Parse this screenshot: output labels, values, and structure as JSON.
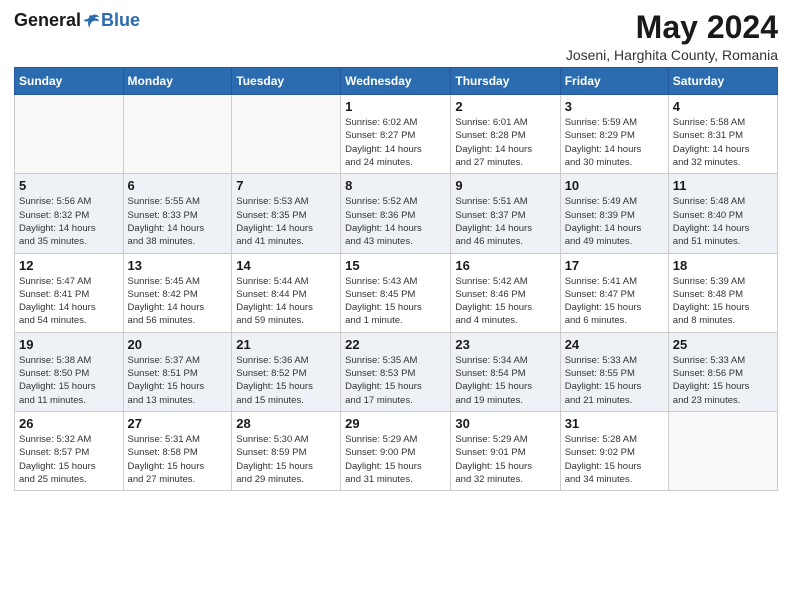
{
  "header": {
    "logo_general": "General",
    "logo_blue": "Blue",
    "month_year": "May 2024",
    "location": "Joseni, Harghita County, Romania"
  },
  "days_of_week": [
    "Sunday",
    "Monday",
    "Tuesday",
    "Wednesday",
    "Thursday",
    "Friday",
    "Saturday"
  ],
  "weeks": [
    [
      {
        "day": "",
        "info": ""
      },
      {
        "day": "",
        "info": ""
      },
      {
        "day": "",
        "info": ""
      },
      {
        "day": "1",
        "info": "Sunrise: 6:02 AM\nSunset: 8:27 PM\nDaylight: 14 hours\nand 24 minutes."
      },
      {
        "day": "2",
        "info": "Sunrise: 6:01 AM\nSunset: 8:28 PM\nDaylight: 14 hours\nand 27 minutes."
      },
      {
        "day": "3",
        "info": "Sunrise: 5:59 AM\nSunset: 8:29 PM\nDaylight: 14 hours\nand 30 minutes."
      },
      {
        "day": "4",
        "info": "Sunrise: 5:58 AM\nSunset: 8:31 PM\nDaylight: 14 hours\nand 32 minutes."
      }
    ],
    [
      {
        "day": "5",
        "info": "Sunrise: 5:56 AM\nSunset: 8:32 PM\nDaylight: 14 hours\nand 35 minutes."
      },
      {
        "day": "6",
        "info": "Sunrise: 5:55 AM\nSunset: 8:33 PM\nDaylight: 14 hours\nand 38 minutes."
      },
      {
        "day": "7",
        "info": "Sunrise: 5:53 AM\nSunset: 8:35 PM\nDaylight: 14 hours\nand 41 minutes."
      },
      {
        "day": "8",
        "info": "Sunrise: 5:52 AM\nSunset: 8:36 PM\nDaylight: 14 hours\nand 43 minutes."
      },
      {
        "day": "9",
        "info": "Sunrise: 5:51 AM\nSunset: 8:37 PM\nDaylight: 14 hours\nand 46 minutes."
      },
      {
        "day": "10",
        "info": "Sunrise: 5:49 AM\nSunset: 8:39 PM\nDaylight: 14 hours\nand 49 minutes."
      },
      {
        "day": "11",
        "info": "Sunrise: 5:48 AM\nSunset: 8:40 PM\nDaylight: 14 hours\nand 51 minutes."
      }
    ],
    [
      {
        "day": "12",
        "info": "Sunrise: 5:47 AM\nSunset: 8:41 PM\nDaylight: 14 hours\nand 54 minutes."
      },
      {
        "day": "13",
        "info": "Sunrise: 5:45 AM\nSunset: 8:42 PM\nDaylight: 14 hours\nand 56 minutes."
      },
      {
        "day": "14",
        "info": "Sunrise: 5:44 AM\nSunset: 8:44 PM\nDaylight: 14 hours\nand 59 minutes."
      },
      {
        "day": "15",
        "info": "Sunrise: 5:43 AM\nSunset: 8:45 PM\nDaylight: 15 hours\nand 1 minute."
      },
      {
        "day": "16",
        "info": "Sunrise: 5:42 AM\nSunset: 8:46 PM\nDaylight: 15 hours\nand 4 minutes."
      },
      {
        "day": "17",
        "info": "Sunrise: 5:41 AM\nSunset: 8:47 PM\nDaylight: 15 hours\nand 6 minutes."
      },
      {
        "day": "18",
        "info": "Sunrise: 5:39 AM\nSunset: 8:48 PM\nDaylight: 15 hours\nand 8 minutes."
      }
    ],
    [
      {
        "day": "19",
        "info": "Sunrise: 5:38 AM\nSunset: 8:50 PM\nDaylight: 15 hours\nand 11 minutes."
      },
      {
        "day": "20",
        "info": "Sunrise: 5:37 AM\nSunset: 8:51 PM\nDaylight: 15 hours\nand 13 minutes."
      },
      {
        "day": "21",
        "info": "Sunrise: 5:36 AM\nSunset: 8:52 PM\nDaylight: 15 hours\nand 15 minutes."
      },
      {
        "day": "22",
        "info": "Sunrise: 5:35 AM\nSunset: 8:53 PM\nDaylight: 15 hours\nand 17 minutes."
      },
      {
        "day": "23",
        "info": "Sunrise: 5:34 AM\nSunset: 8:54 PM\nDaylight: 15 hours\nand 19 minutes."
      },
      {
        "day": "24",
        "info": "Sunrise: 5:33 AM\nSunset: 8:55 PM\nDaylight: 15 hours\nand 21 minutes."
      },
      {
        "day": "25",
        "info": "Sunrise: 5:33 AM\nSunset: 8:56 PM\nDaylight: 15 hours\nand 23 minutes."
      }
    ],
    [
      {
        "day": "26",
        "info": "Sunrise: 5:32 AM\nSunset: 8:57 PM\nDaylight: 15 hours\nand 25 minutes."
      },
      {
        "day": "27",
        "info": "Sunrise: 5:31 AM\nSunset: 8:58 PM\nDaylight: 15 hours\nand 27 minutes."
      },
      {
        "day": "28",
        "info": "Sunrise: 5:30 AM\nSunset: 8:59 PM\nDaylight: 15 hours\nand 29 minutes."
      },
      {
        "day": "29",
        "info": "Sunrise: 5:29 AM\nSunset: 9:00 PM\nDaylight: 15 hours\nand 31 minutes."
      },
      {
        "day": "30",
        "info": "Sunrise: 5:29 AM\nSunset: 9:01 PM\nDaylight: 15 hours\nand 32 minutes."
      },
      {
        "day": "31",
        "info": "Sunrise: 5:28 AM\nSunset: 9:02 PM\nDaylight: 15 hours\nand 34 minutes."
      },
      {
        "day": "",
        "info": ""
      }
    ]
  ]
}
